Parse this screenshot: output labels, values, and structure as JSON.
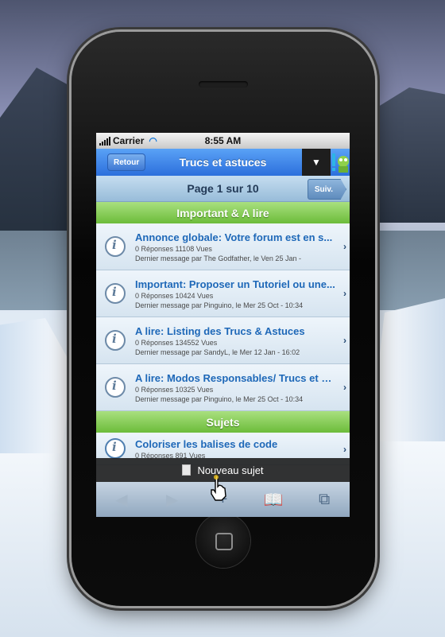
{
  "status_bar": {
    "carrier": "Carrier",
    "time": "8:55 AM"
  },
  "nav": {
    "back_label": "Retour",
    "title": "Trucs et astuces",
    "menu_icon": "triangle-down"
  },
  "pager": {
    "label": "Page 1 sur 10",
    "next_label": "Suiv."
  },
  "sections": {
    "important": "Important & A lire",
    "topics": "Sujets"
  },
  "important_topics": [
    {
      "title": "Annonce globale: Votre forum est en s...",
      "stats": "0 Réponses 11108 Vues",
      "last": "Dernier message par The Godfather, le Ven 25 Jan -"
    },
    {
      "title": "Important: Proposer un Tutoriel ou une...",
      "stats": "0 Réponses 10424 Vues",
      "last": "Dernier message par Pinguino, le Mer 25 Oct - 10:34"
    },
    {
      "title": "A lire: Listing des Trucs & Astuces",
      "stats": "0 Réponses 134552 Vues",
      "last": "Dernier message par SandyL, le Mer 12 Jan - 16:02"
    },
    {
      "title": "A lire: Modos Responsables/ Trucs et a...",
      "stats": "0 Réponses 10325 Vues",
      "last": "Dernier message par Pinguino, le Mer 25 Oct - 10:34"
    }
  ],
  "topics": [
    {
      "title": "Coloriser les balises de code",
      "stats": "0 Réponses 891 Vues"
    }
  ],
  "new_topic": {
    "label": "Nouveau sujet"
  },
  "toolbar": {
    "back": "◀",
    "forward": "▶",
    "share": "+",
    "bookmarks": "📖",
    "pages": "⧉"
  }
}
